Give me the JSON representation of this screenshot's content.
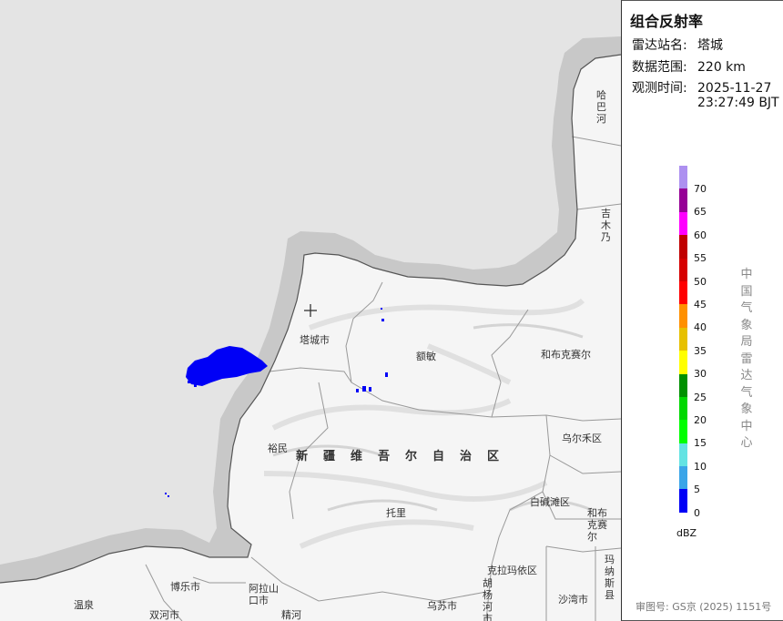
{
  "panel": {
    "title": "组合反射率",
    "station_label": "雷达站名:",
    "station": "塔城",
    "range_label": "数据范围:",
    "range": "220 km",
    "time_label": "观测时间:",
    "time_date": "2025-11-27",
    "time_clock": "23:27:49 BJT",
    "unit": "dBZ",
    "vertical_text": "中国气象局雷达气象中心",
    "approval": "审图号: GS京 (2025) 1151号"
  },
  "scale": [
    {
      "label": "70",
      "color": "#ad90f0"
    },
    {
      "label": "65",
      "color": "#960096"
    },
    {
      "label": "60",
      "color": "#ff00ff"
    },
    {
      "label": "55",
      "color": "#c00000"
    },
    {
      "label": "50",
      "color": "#d60000"
    },
    {
      "label": "45",
      "color": "#ff0000"
    },
    {
      "label": "40",
      "color": "#ff9000"
    },
    {
      "label": "35",
      "color": "#e7c000"
    },
    {
      "label": "30",
      "color": "#ffff00"
    },
    {
      "label": "25",
      "color": "#009000"
    },
    {
      "label": "20",
      "color": "#00d800"
    },
    {
      "label": "15",
      "color": "#01ff01"
    },
    {
      "label": "10",
      "color": "#63e3e3"
    },
    {
      "label": "5",
      "color": "#3aa5e8"
    },
    {
      "label": "0",
      "color": "#0000f6"
    }
  ],
  "map": {
    "places": {
      "tacheng": "塔城市",
      "emin": "额敏",
      "hebukesaier": "和布克赛尔",
      "yumin": "裕民",
      "xinjiang": "新疆维吾尔自治区",
      "wuerhe": "乌尔禾区",
      "baijiantan": "白碱滩区",
      "hebukesaier2": "和布克赛尔",
      "tuoli": "托里",
      "kelamayi": "克拉玛依区",
      "shawan": "沙湾市",
      "wusu": "乌苏市",
      "bole": "博乐市",
      "alashankou": "阿拉山口市",
      "wenquan": "温泉",
      "jinghe": "精河",
      "shuanghe": "双河市",
      "habahe": "哈巴河",
      "jimunai": "吉木乃",
      "manasi": "玛纳斯县",
      "hutubi": "胡杨河市"
    }
  },
  "colors": {
    "outside": "#e4e4e4",
    "border_buffer": "#c8c8c8",
    "land": "#f4f4f4",
    "echo": "#0000f6"
  }
}
